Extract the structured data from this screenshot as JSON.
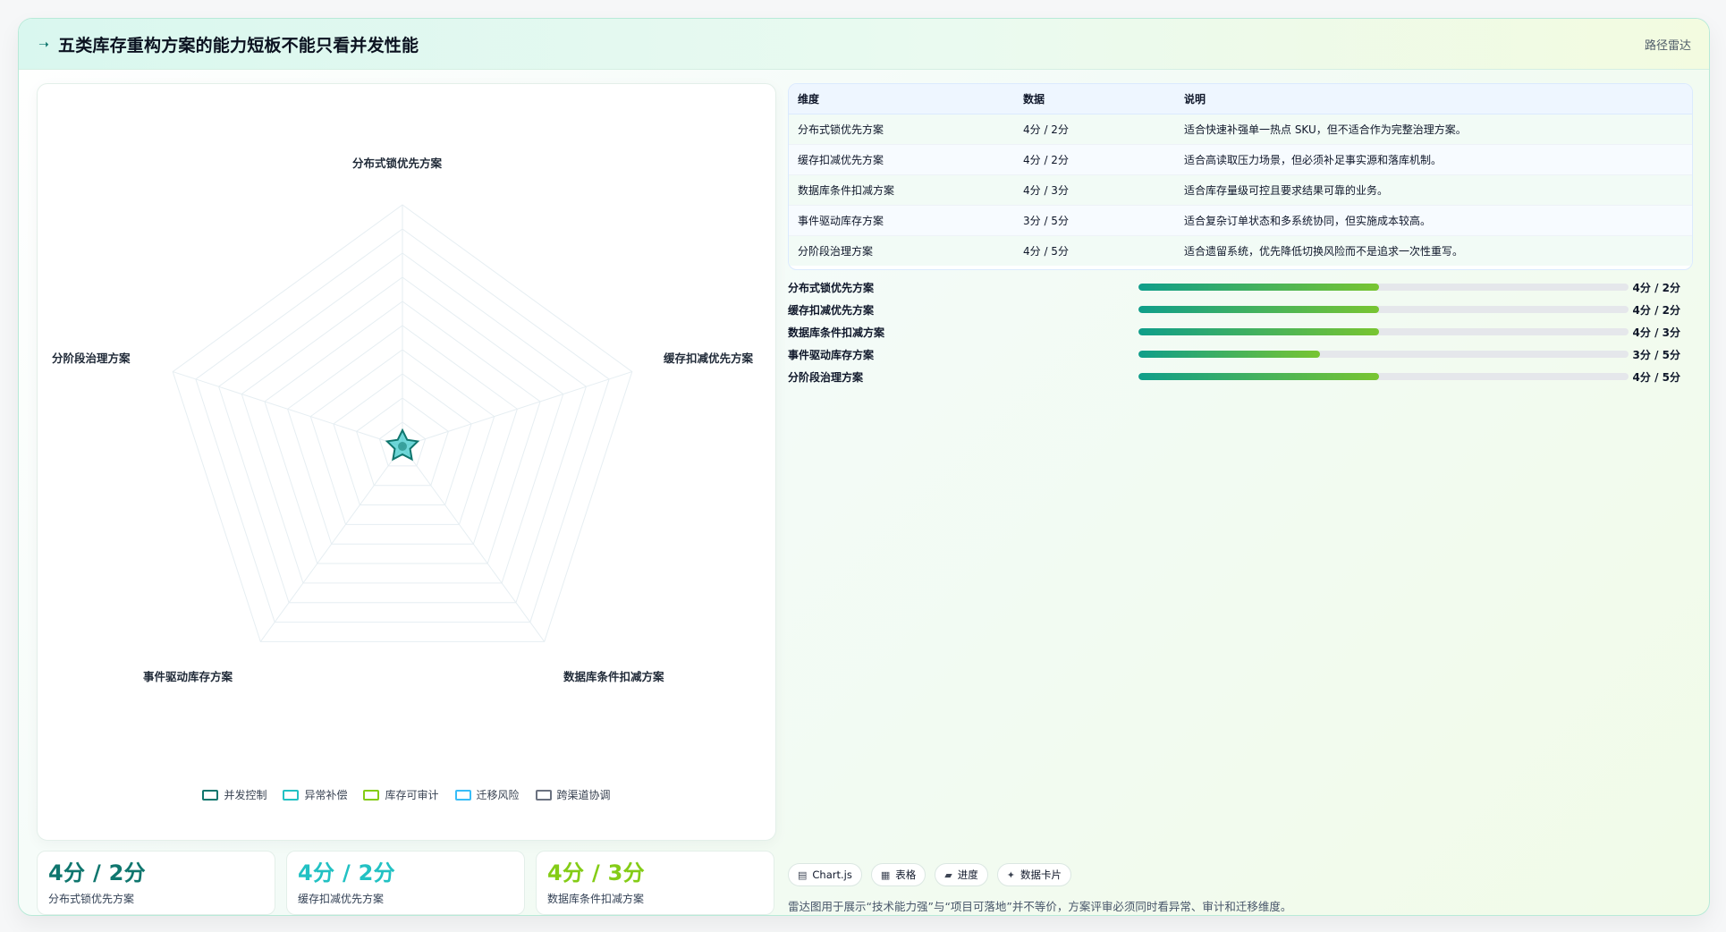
{
  "header": {
    "icon": "spark-icon",
    "title": "五类库存重构方案的能力短板不能只看并发性能",
    "right_label": "路径雷达"
  },
  "chart_data": [
    {
      "type": "radar",
      "axes": [
        "分布式锁优先方案",
        "缓存扣减优先方案",
        "数据库条件扣减方案",
        "事件驱动库存方案",
        "分阶段治理方案"
      ],
      "legend": [
        {
          "name": "并发控制",
          "color": "#0f766e"
        },
        {
          "name": "异常补偿",
          "color": "#22c1c3"
        },
        {
          "name": "库存可审计",
          "color": "#84cc16"
        },
        {
          "name": "迁移风险",
          "color": "#38bdf8"
        },
        {
          "name": "跨渠道协调",
          "color": "#6b7280"
        }
      ],
      "grid": true
    }
  ],
  "table": {
    "headers": [
      "维度",
      "数据",
      "说明"
    ],
    "rows": [
      [
        "分布式锁优先方案",
        "4分 / 2分",
        "适合快速补强单一热点 SKU，但不适合作为完整治理方案。"
      ],
      [
        "缓存扣减优先方案",
        "4分 / 2分",
        "适合高读取压力场景，但必须补足事实源和落库机制。"
      ],
      [
        "数据库条件扣减方案",
        "4分 / 3分",
        "适合库存量级可控且要求结果可靠的业务。"
      ],
      [
        "事件驱动库存方案",
        "3分 / 5分",
        "适合复杂订单状态和多系统协同，但实施成本较高。"
      ],
      [
        "分阶段治理方案",
        "4分 / 5分",
        "适合遗留系统，优先降低切换风险而不是追求一次性重写。"
      ]
    ]
  },
  "bars": [
    {
      "name": "分布式锁优先方案",
      "value": "4分 / 2分",
      "progress": 0.49
    },
    {
      "name": "缓存扣减优先方案",
      "value": "4分 / 2分",
      "progress": 0.49
    },
    {
      "name": "数据库条件扣减方案",
      "value": "4分 / 3分",
      "progress": 0.49
    },
    {
      "name": "事件驱动库存方案",
      "value": "3分 / 5分",
      "progress": 0.37
    },
    {
      "name": "分阶段治理方案",
      "value": "4分 / 5分",
      "progress": 0.49
    }
  ],
  "stats": [
    {
      "value": "4分 / 2分",
      "label": "分布式锁优先方案",
      "color": "#0f766e"
    },
    {
      "value": "4分 / 2分",
      "label": "缓存扣减优先方案",
      "color": "#22c1c3"
    },
    {
      "value": "4分 / 3分",
      "label": "数据库条件扣减方案",
      "color": "#84cc16"
    }
  ],
  "chips": [
    {
      "icon": "chart-icon",
      "label": "Chart.js",
      "glyph": "▤"
    },
    {
      "icon": "table-icon",
      "label": "表格",
      "glyph": "▦"
    },
    {
      "icon": "progress-icon",
      "label": "进度",
      "glyph": "▰"
    },
    {
      "icon": "card-icon",
      "label": "数据卡片",
      "glyph": "✦"
    }
  ],
  "note": "雷达图用于展示“技术能力强”与“项目可落地”并不等价，方案评审必须同时看异常、审计和迁移维度。"
}
